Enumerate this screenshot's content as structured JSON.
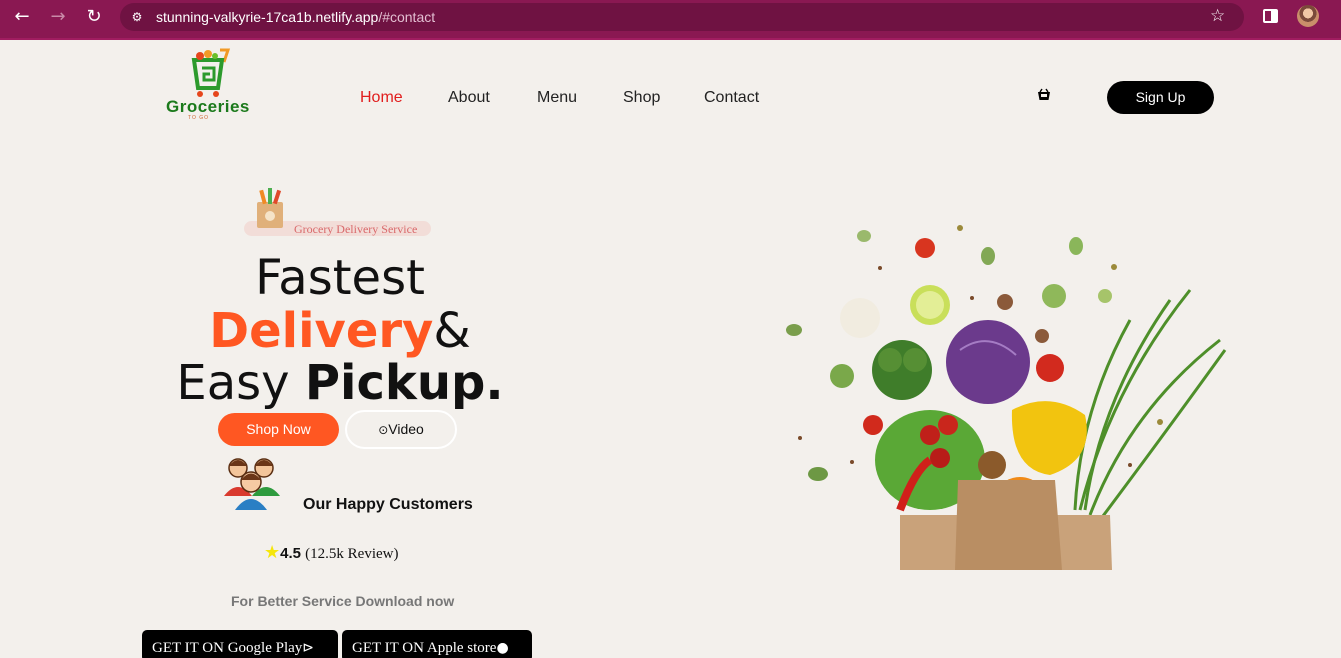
{
  "browser": {
    "url_host": "stunning-valkyrie-17ca1b.netlify.app",
    "url_path": "/#contact",
    "back_icon": "arrow-left-icon",
    "forward_icon": "arrow-right-icon",
    "reload_icon": "reload-icon"
  },
  "header": {
    "logo_text": "Groceries",
    "logo_subtext": "TO GO",
    "nav": [
      {
        "label": "Home",
        "active": true
      },
      {
        "label": "About",
        "active": false
      },
      {
        "label": "Menu",
        "active": false
      },
      {
        "label": "Shop",
        "active": false
      },
      {
        "label": "Contact",
        "active": false
      }
    ],
    "cart_icon": "cart-icon",
    "signup_label": "Sign Up"
  },
  "hero": {
    "badge": "Grocery Delivery Service",
    "line1": "Fastest",
    "line2_highlight": "Delivery",
    "line2_rest": "&",
    "line3_normal": "Easy ",
    "line3_bold": "Pickup.",
    "shop_now_label": "Shop Now",
    "video_label": "Video",
    "customers_label": "Our Happy Customers",
    "rating_value": "4.5",
    "rating_reviews": "(12.5k Review)",
    "download_text": "For Better Service Download now",
    "google_play_label": "GET IT ON Google Play",
    "apple_store_label": "GET IT ON Apple store"
  },
  "colors": {
    "chrome": "#8a1852",
    "accent": "#ff5722",
    "active_nav": "#e11d1d",
    "background": "#f3f0ec"
  }
}
